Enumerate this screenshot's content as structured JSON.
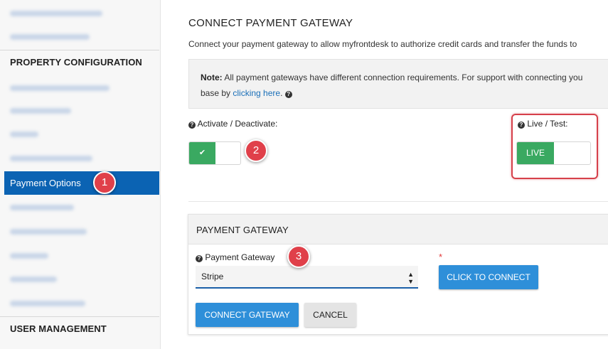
{
  "sidebar": {
    "section_property": "PROPERTY CONFIGURATION",
    "active_item": "Payment Options",
    "section_user": "USER MANAGEMENT"
  },
  "callouts": [
    "1",
    "2",
    "3"
  ],
  "main": {
    "title": "CONNECT PAYMENT GATEWAY",
    "description": "Connect your payment gateway to allow myfrontdesk to authorize credit cards and transfer the funds to",
    "note": {
      "label": "Note:",
      "line1": " All payment gateways have different connection requirements. For support with connecting you",
      "line2_prefix": "base by ",
      "link": "clicking here",
      "line2_suffix": ". "
    },
    "activate_label": "Activate / Deactivate:",
    "activate_checkmark": "✔",
    "live_test_label": "Live / Test:",
    "live_value": "LIVE",
    "panel_title": "PAYMENT GATEWAY",
    "gateway_label": "Payment Gateway",
    "gateway_value": "Stripe",
    "required_mark": "*",
    "click_to_connect": "CLICK TO CONNECT",
    "connect_gateway": "CONNECT GATEWAY",
    "cancel": "CANCEL"
  },
  "icons": {
    "help": "question-circle-icon",
    "check": "check-icon",
    "select_arrows": "up-down-arrow-icon"
  },
  "colors": {
    "sidebar_active": "#0b63b3",
    "toggle_on": "#3aa961",
    "primary_button": "#2e8fd9",
    "callout": "#e0404a",
    "highlight_border": "#d6404a"
  }
}
